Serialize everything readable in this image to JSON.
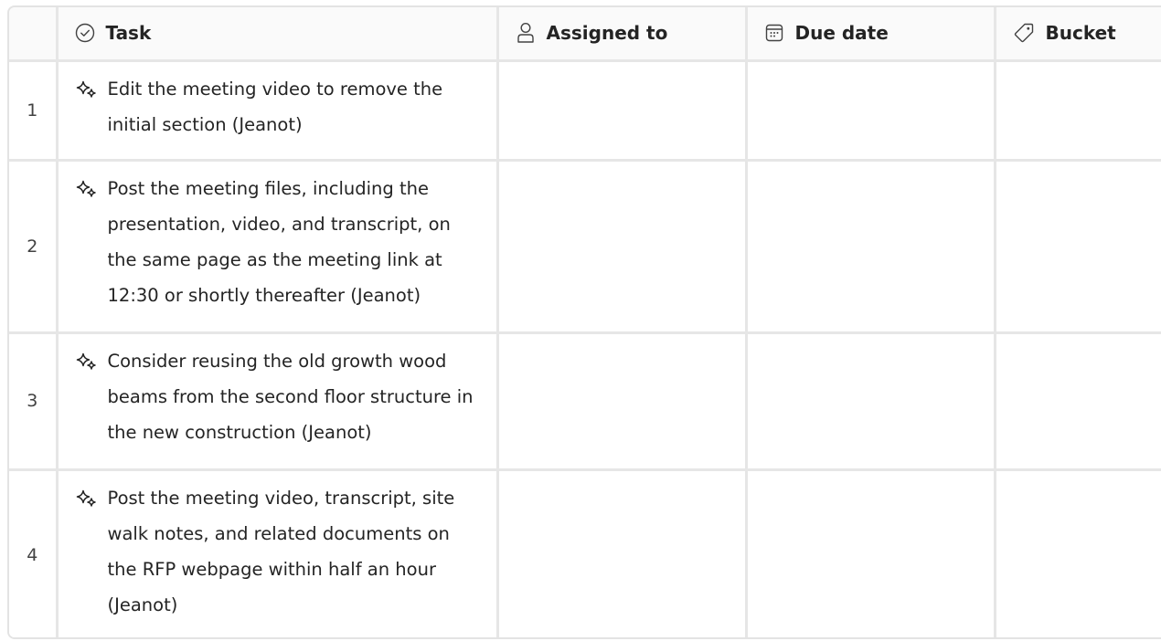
{
  "table": {
    "columns": {
      "task": "Task",
      "assigned_to": "Assigned to",
      "due_date": "Due date",
      "bucket": "Bucket"
    },
    "rows": [
      {
        "number": "1",
        "task": "Edit the meeting video to remove the initial section (Jeanot)",
        "task_icon": "sparkle-icon",
        "assigned_to": "",
        "due_date": "",
        "bucket": ""
      },
      {
        "number": "2",
        "task": "Post the meeting files, including the presentation, video, and transcript, on the same page as the meeting link at 12:30 or shortly thereafter (Jeanot)",
        "task_icon": "sparkle-icon",
        "assigned_to": "",
        "due_date": "",
        "bucket": ""
      },
      {
        "number": "3",
        "task": "Consider reusing the old growth wood beams from the second floor structure in the new construction (Jeanot)",
        "task_icon": "sparkle-icon",
        "assigned_to": "",
        "due_date": "",
        "bucket": ""
      },
      {
        "number": "4",
        "task": "Post the meeting video, transcript, site walk notes, and related documents on the RFP webpage within half an hour (Jeanot)",
        "task_icon": "sparkle-icon",
        "assigned_to": "",
        "due_date": "",
        "bucket": ""
      }
    ]
  },
  "icons": {
    "task": "circle-check-icon",
    "assigned_to": "person-icon",
    "due_date": "calendar-icon",
    "bucket": "tag-icon"
  },
  "colors": {
    "border": "#e6e6e6",
    "header_bg": "#fafafa",
    "text": "#242424"
  }
}
